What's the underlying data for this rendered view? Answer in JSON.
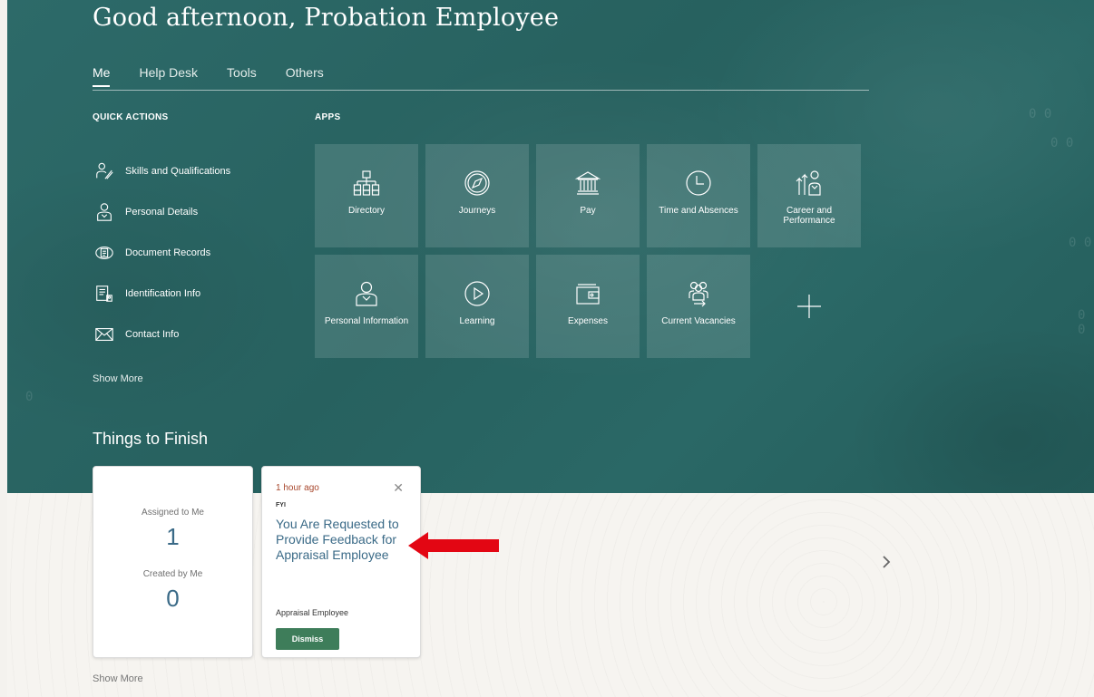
{
  "greeting": "Good afternoon, Probation Employee",
  "tabs": [
    {
      "label": "Me",
      "active": true
    },
    {
      "label": "Help Desk",
      "active": false
    },
    {
      "label": "Tools",
      "active": false
    },
    {
      "label": "Others",
      "active": false
    }
  ],
  "quick_actions": {
    "title": "QUICK ACTIONS",
    "items": [
      {
        "label": "Skills and Qualifications",
        "icon": "skills-icon"
      },
      {
        "label": "Personal Details",
        "icon": "person-icon"
      },
      {
        "label": "Document Records",
        "icon": "document-icon"
      },
      {
        "label": "Identification Info",
        "icon": "id-card-icon"
      },
      {
        "label": "Contact Info",
        "icon": "envelope-icon"
      }
    ],
    "show_more": "Show More"
  },
  "apps": {
    "title": "APPS",
    "tiles": [
      {
        "label": "Directory",
        "icon": "org-chart-icon"
      },
      {
        "label": "Journeys",
        "icon": "compass-icon"
      },
      {
        "label": "Pay",
        "icon": "bank-icon"
      },
      {
        "label": "Time and Absences",
        "icon": "clock-icon"
      },
      {
        "label": "Career and Performance",
        "icon": "career-icon"
      },
      {
        "label": "Personal Information",
        "icon": "person-icon"
      },
      {
        "label": "Learning",
        "icon": "play-icon"
      },
      {
        "label": "Expenses",
        "icon": "wallet-icon"
      },
      {
        "label": "Current Vacancies",
        "icon": "group-icon"
      }
    ]
  },
  "things_to_finish": {
    "title": "Things to Finish",
    "assigned_label": "Assigned to Me",
    "assigned_count": "1",
    "created_label": "Created by Me",
    "created_count": "0",
    "show_more": "Show More"
  },
  "notification": {
    "time": "1 hour ago",
    "type": "FYI",
    "title": "You Are Requested to Provide Feedback for Appraisal Employee",
    "subtitle": "Appraisal Employee",
    "dismiss_label": "Dismiss"
  },
  "colors": {
    "hero": "#2a6664",
    "link": "#3a6a87",
    "dismiss": "#3e7d5a",
    "time": "#a8472d",
    "annotation_arrow": "#e30613"
  }
}
